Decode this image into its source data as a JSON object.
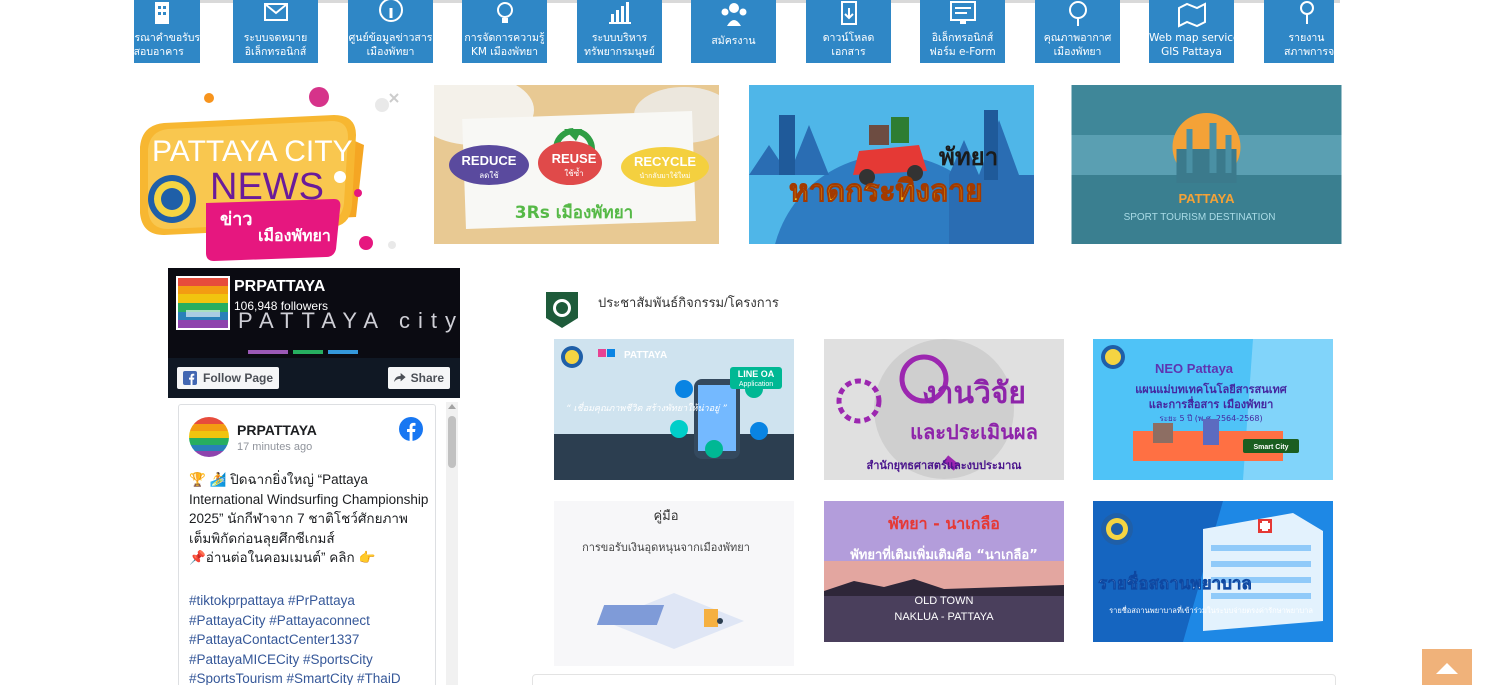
{
  "services": [
    {
      "line1": "ผลการพิจารณาคำขอรับรอง",
      "line2": "การตรวจสอบอาคาร",
      "icon": "building-icon"
    },
    {
      "line1": "ระบบจดหมาย",
      "line2": "อิเล็กทรอนิกส์",
      "icon": "mail-icon"
    },
    {
      "line1": "ศูนย์ข้อมูลข่าวสาร",
      "line2": "เมืองพัทยา",
      "icon": "info-icon"
    },
    {
      "line1": "การจัดการความรู้",
      "line2": "KM เมืองพัทยา",
      "icon": "lightbulb-icon"
    },
    {
      "line1": "ระบบบริหาร",
      "line2": "ทรัพยากรมนุษย์",
      "icon": "people-chart-icon"
    },
    {
      "line1": "สมัครงาน",
      "line2": "",
      "icon": "team-icon"
    },
    {
      "line1": "ดาวน์โหลด",
      "line2": "เอกสาร",
      "icon": "download-icon"
    },
    {
      "line1": "อิเล็กทรอนิกส์",
      "line2": "ฟอร์ม e-Form",
      "icon": "monitor-form-icon"
    },
    {
      "line1": "คุณภาพอากาศ",
      "line2": "เมืองพัทยา",
      "icon": "air-quality-icon"
    },
    {
      "line1": "Web map service",
      "line2": "GIS Pattaya",
      "icon": "map-icon"
    },
    {
      "line1": "รายงาน",
      "line2": "สภาพการจราจร",
      "icon": "traffic-icon"
    }
  ],
  "news_logo": {
    "line1": "PATTAYA CITY",
    "line2": "NEWS",
    "line3": "ข่าว",
    "line4": "เมืองพัทยา"
  },
  "banners": {
    "b1": {
      "reduce": "REDUCE",
      "reduce_sub": "ลดใช้",
      "reuse": "REUSE",
      "reuse_sub": "ใช้ซ้ำ",
      "recycle": "RECYCLE",
      "recycle_sub": "นำกลับมาใช้ใหม่",
      "caption": "3Rs เมืองพัทยา"
    },
    "b2": {
      "title1": "พัทยา",
      "title2": "หาดกระทิงลาย"
    },
    "b3": {
      "title": "PATTAYA",
      "subtitle": "SPORT TOURISM DESTINATION"
    }
  },
  "facebook": {
    "page_name": "PRPATTAYA",
    "followers": "106,948 followers",
    "follow_label": "Follow Page",
    "share_label": "Share",
    "cover_text": "PATTAYA city",
    "post": {
      "author": "PRPATTAYA",
      "time": "17 minutes ago",
      "text1": "🏆 🏄 ปิดฉากยิ่งใหญ่ “Pattaya International Windsurfing Championship 2025” นักกีฬาจาก 7 ชาติโชว์ศักยภาพเต็มพิกัดก่อนลุยศึกซีเกมส์",
      "text2": "📌อ่านต่อในคอมเมนต์” คลิก 👉",
      "tags": "#tiktokprpattaya #PrPattaya #PattayaCity #Pattayaconnect #PattayaContactCenter1337 #PattayaMICECity #SportsCity #SportsTourism #SmartCity #ThaiD"
    }
  },
  "section": {
    "title": "ประชาสัมพันธ์กิจกรรม/โครงการ"
  },
  "tiles": {
    "t1": {
      "brand": "PATTAYA",
      "badge1": "LINE OA",
      "badge2": "Application",
      "text": "“ เชื่อมคุณภาพชีวิต สร้างพัทยาให้น่าอยู่ ”"
    },
    "t2": {
      "title1": "งานวิจัย",
      "title2": "และประเมินผล",
      "caption": "สำนักยุทธศาสตร์และงบประมาณ"
    },
    "t3": {
      "brand": "NEO Pattaya",
      "title1": "แผนแม่บทเทคโนโลยีสารสนเทศ",
      "title2": "และการสื่อสาร เมืองพัทยา",
      "title3": "ระยะ 5 ปี (พ.ศ. 2564-2568)",
      "tag": "Smart City"
    },
    "t4": {
      "title": "คู่มือ",
      "subtitle": "การขอรับเงินอุดหนุนจากเมืองพัทยา"
    },
    "t5": {
      "title1": "พัทยา - นาเกลือ",
      "title2": "พัทยาที่เติมเพิ่มเติมคือ “นาเกลือ”",
      "foot1": "OLD TOWN",
      "foot2": "NAKLUA - PATTAYA"
    },
    "t6": {
      "title": "รายชื่อสถานพยาบาล",
      "caption": "รายชื่อสถานพยาบาลที่เข้าร่วมในระบบจ่ายตรงค่ารักษาพยาบาล"
    }
  },
  "colors": {
    "service_bg": "#2f87c6",
    "fb_link": "#365899",
    "to_top": "#f0b27a"
  }
}
